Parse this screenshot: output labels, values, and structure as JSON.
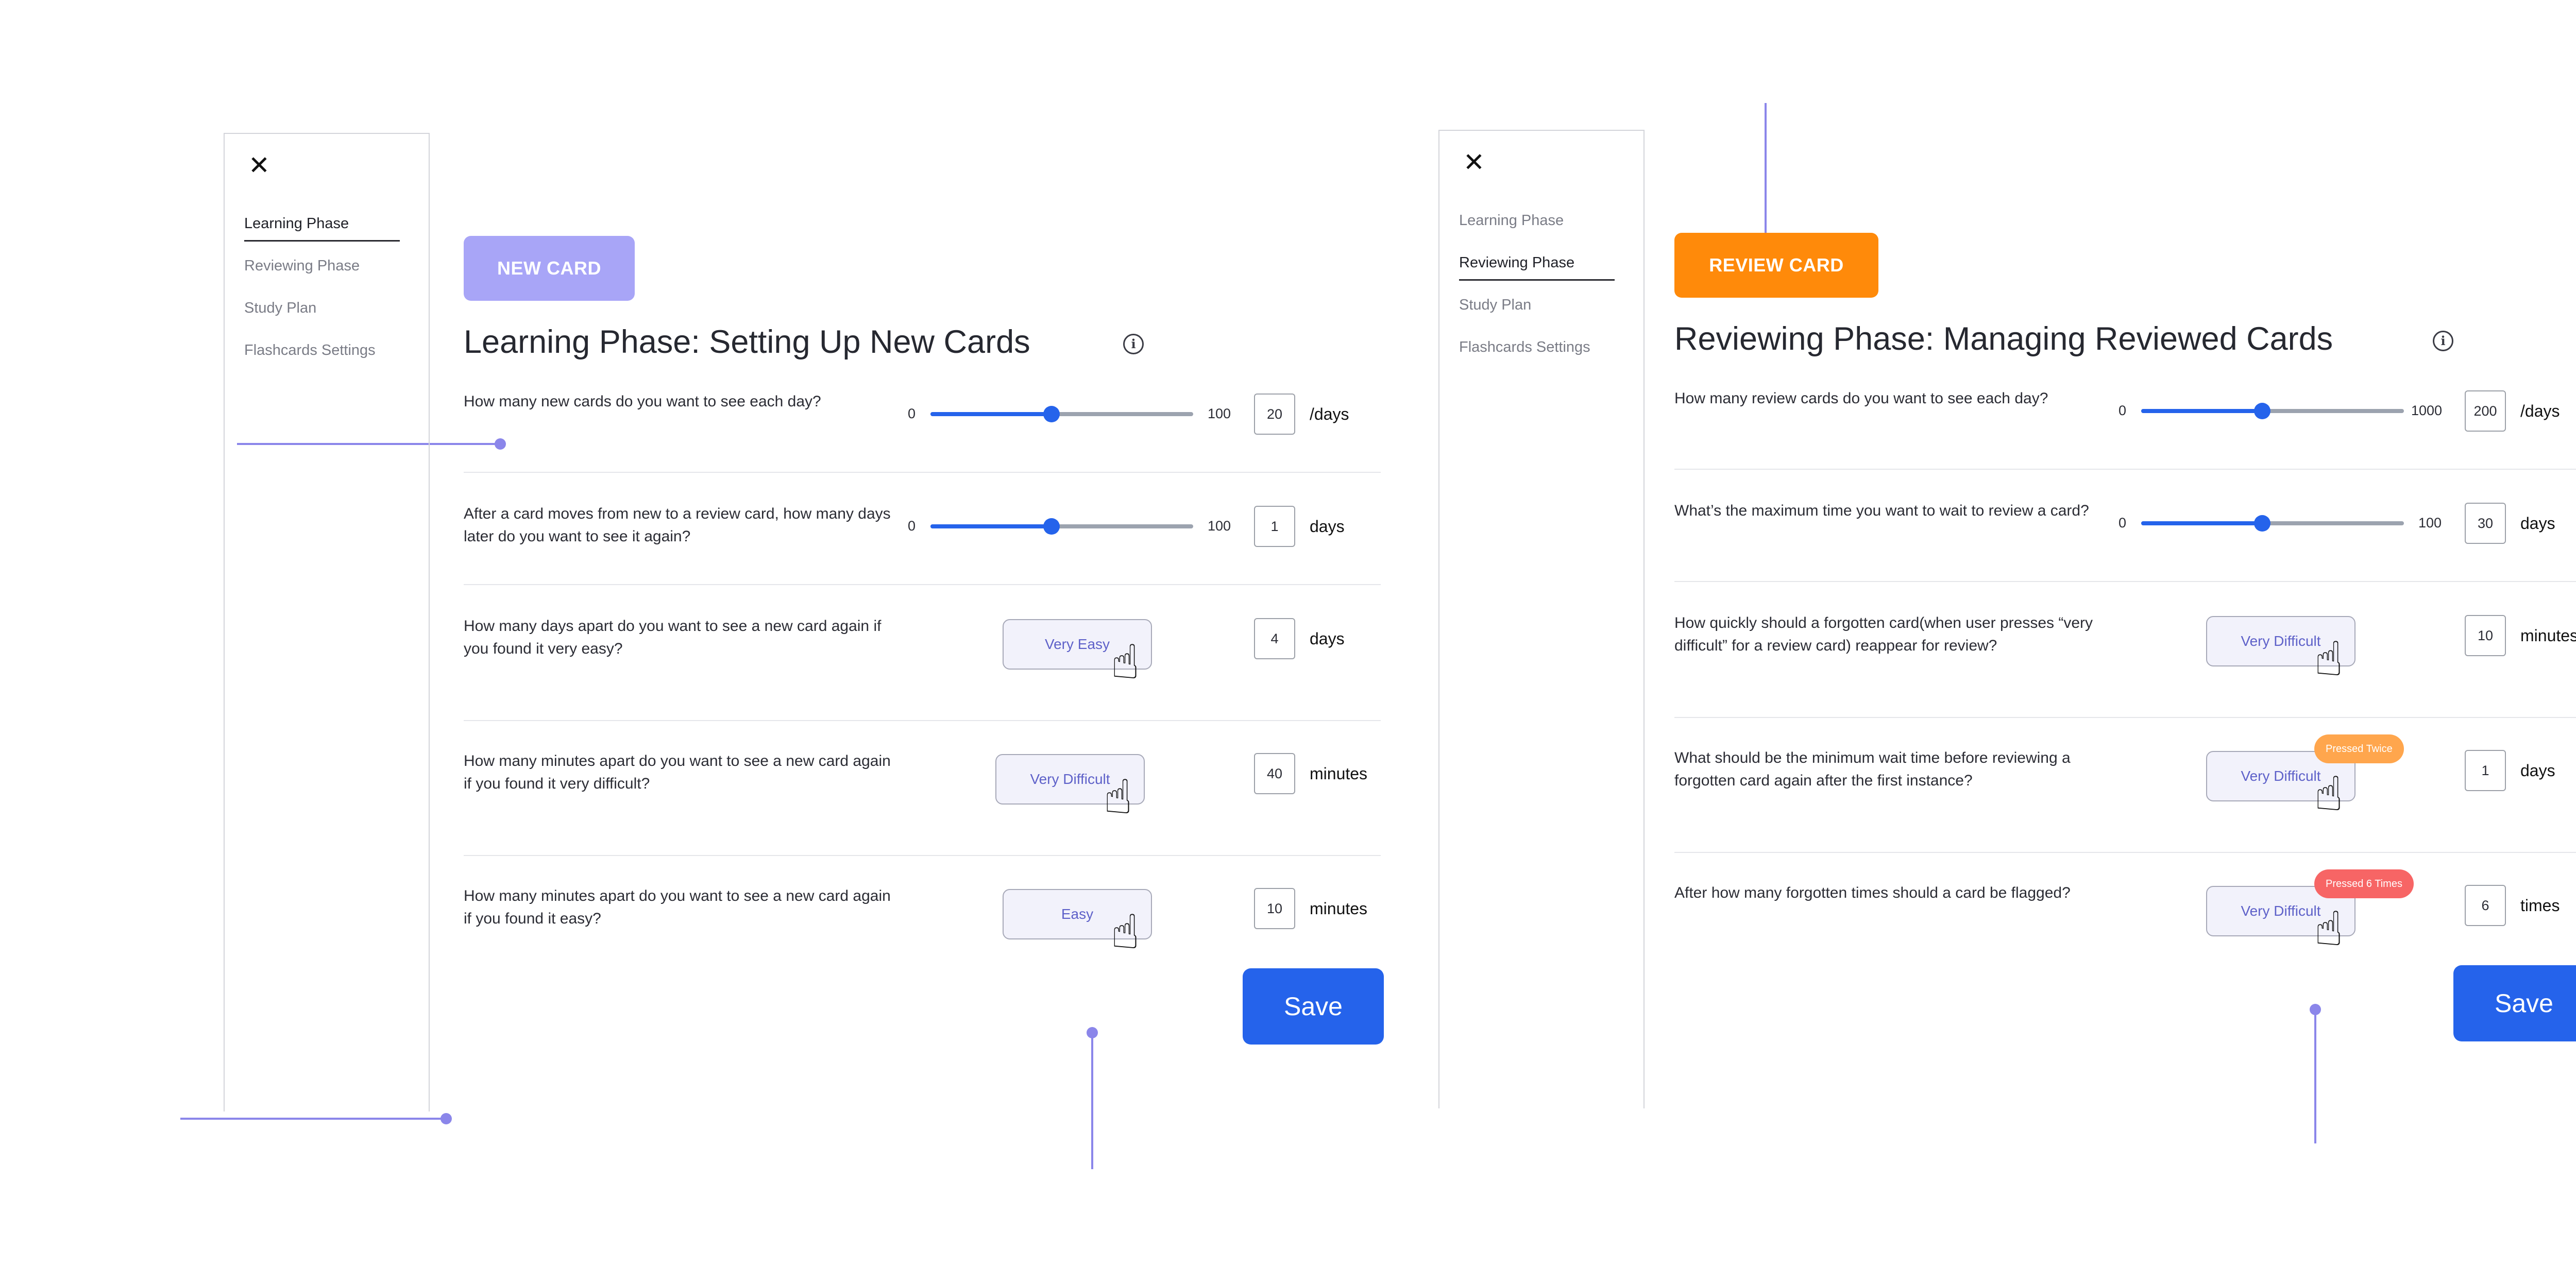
{
  "colors": {
    "accent_blue": "#2563eb",
    "annotation_purple": "#8b86ea",
    "new_card_chip": "#a8a5f7",
    "review_card_chip": "#ff8a0a",
    "badge_orange": "#ffa64d",
    "badge_red": "#f76565"
  },
  "left": {
    "sidebar": {
      "items": [
        {
          "label": "Learning Phase"
        },
        {
          "label": "Reviewing Phase"
        },
        {
          "label": "Study Plan"
        },
        {
          "label": "Flashcards Settings"
        }
      ]
    },
    "chip": "NEW CARD",
    "title": "Learning Phase: Setting Up New Cards",
    "rows": [
      {
        "question": "How many new cards do you want to see each day?",
        "min": "0",
        "max": "100",
        "value": "20",
        "unit": "/days",
        "fraction": 0.46
      },
      {
        "question": "After a card moves from new to a review card, how many days later do you want to see it again?",
        "min": "0",
        "max": "100",
        "value": "1",
        "unit": "days",
        "fraction": 0.46
      },
      {
        "question": "How many days apart do you want to see a new card again if you found it very easy?",
        "button": "Very Easy",
        "value": "4",
        "unit": "days"
      },
      {
        "question": "How many minutes apart do you want to see a new card again if you found it very difficult?",
        "button": "Very Difficult",
        "value": "40",
        "unit": "minutes"
      },
      {
        "question": "How many minutes apart do you want to see a new card again if you found it easy?",
        "button": "Easy",
        "value": "10",
        "unit": "minutes"
      }
    ],
    "save": "Save"
  },
  "right": {
    "sidebar": {
      "items": [
        {
          "label": "Learning Phase"
        },
        {
          "label": "Reviewing Phase"
        },
        {
          "label": "Study Plan"
        },
        {
          "label": "Flashcards Settings"
        }
      ]
    },
    "chip": "REVIEW CARD",
    "title": "Reviewing Phase: Managing Reviewed Cards",
    "rows": [
      {
        "question": "How many review cards do you want to see each day?",
        "min": "0",
        "max": "1000",
        "value": "200",
        "unit": "/days",
        "fraction": 0.46
      },
      {
        "question": "What’s the maximum time you want to wait to review a card?",
        "min": "0",
        "max": "100",
        "value": "30",
        "unit": "days",
        "fraction": 0.46
      },
      {
        "question": "How quickly should a forgotten card(when user presses “very difficult” for a review card) reappear for review?",
        "button": "Very Difficult",
        "value": "10",
        "unit": "minutes"
      },
      {
        "question": "What should be the minimum wait time before reviewing a forgotten card again after the first instance?",
        "button": "Very Difficult",
        "value": "1",
        "unit": "days",
        "badge": "Pressed Twice"
      },
      {
        "question": "After how many forgotten times should a card be flagged?",
        "button": "Very Difficult",
        "value": "6",
        "unit": "times",
        "badge": "Pressed 6 Times"
      }
    ],
    "save": "Save"
  },
  "icons": {
    "close": "close-icon",
    "info": "info-icon",
    "pointer": "hand-pointer-icon"
  }
}
